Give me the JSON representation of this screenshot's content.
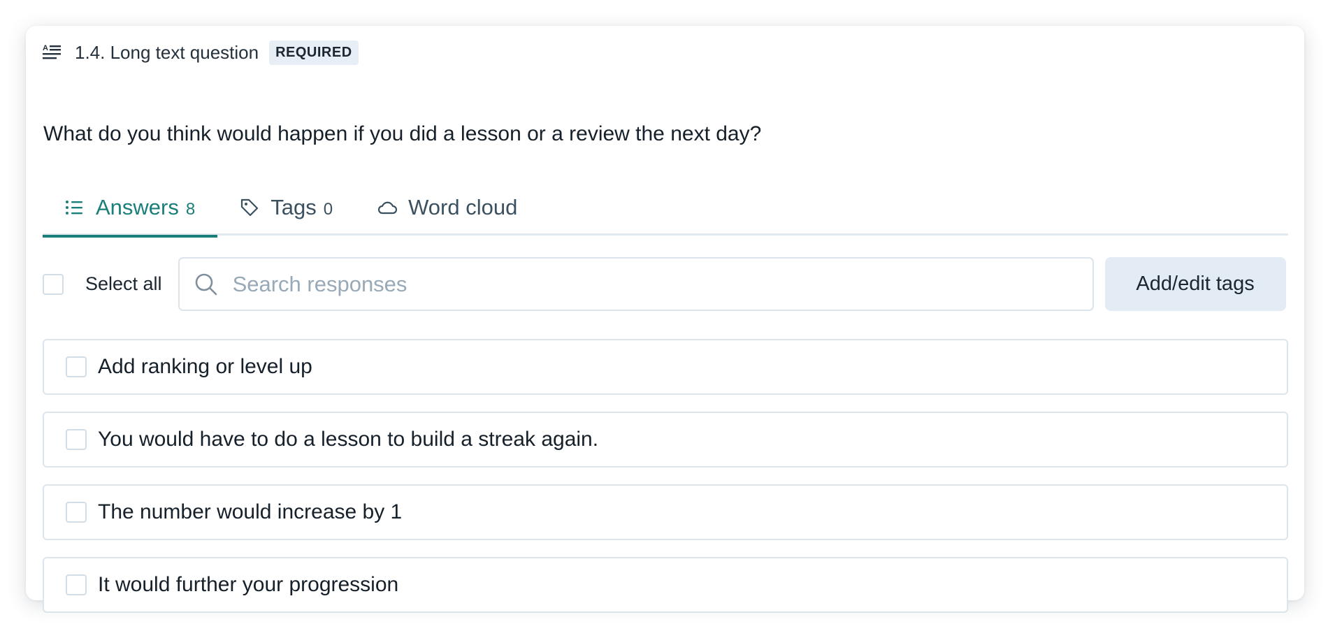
{
  "question": {
    "number_title": "1.4. Long text question",
    "badge": "REQUIRED",
    "text": "What do you think would happen if you did a lesson or a review the next day?",
    "type_icon": "long-text-icon"
  },
  "tabs": [
    {
      "label": "Answers",
      "count": "8",
      "icon": "list-icon",
      "active": true
    },
    {
      "label": "Tags",
      "count": "0",
      "icon": "tag-icon",
      "active": false
    },
    {
      "label": "Word cloud",
      "count": "",
      "icon": "cloud-icon",
      "active": false
    }
  ],
  "toolbar": {
    "select_all_label": "Select all",
    "search_placeholder": "Search responses",
    "search_value": "",
    "tags_button_label": "Add/edit tags"
  },
  "answers": [
    {
      "text": "Add ranking or level up"
    },
    {
      "text": "You would have to do a lesson to build a streak again."
    },
    {
      "text": "The number would increase by 1"
    },
    {
      "text": "It would further your progression"
    }
  ],
  "colors": {
    "accent": "#1b7f79",
    "tab_text": "#3b5160",
    "badge_bg": "#e7eef6",
    "button_bg": "#e3ecf5",
    "border": "#dbe5ee",
    "placeholder": "#98a9b7"
  }
}
